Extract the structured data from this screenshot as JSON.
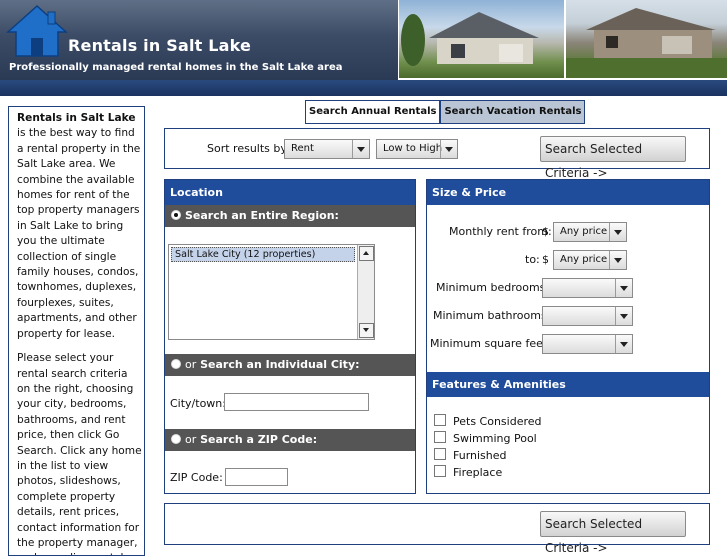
{
  "header": {
    "title": "Rentals in Salt Lake",
    "tagline": "Professionally managed rental homes in the Salt Lake area"
  },
  "sidebar": {
    "intro_bold": "Rentals in Salt Lake",
    "intro_rest": " is the best way to find a rental property in the Salt Lake area. We combine the available homes for rent of the top property managers in Salt Lake to bring you the ultimate collection of single family houses, condos, townhomes, duplexes, fourplexes, suites, apartments, and other property for lease.",
    "para2": "Please select your rental search criteria on the right, choosing your city, bedrooms, bathrooms, and rent price, then click Go Search. Click any home in the list to view photos, slideshows, complete property details, rent prices, contact information for the property manager, and an online rental"
  },
  "tabs": [
    "Search Annual Rentals",
    "Search Vacation Rentals"
  ],
  "sort": {
    "label": "Sort results by:",
    "field": "Rent",
    "order": "Low to High",
    "button": "Search Selected Criteria ->"
  },
  "location": {
    "title": "Location",
    "region_head": "Search an Entire Region:",
    "region_option": "Salt Lake City (12 properties)",
    "city_or": "or",
    "city_head": "Search an Individual City:",
    "city_label": "City/town:",
    "zip_or": "or",
    "zip_head": "Search a ZIP Code:",
    "zip_label": "ZIP Code:"
  },
  "size_price": {
    "title": "Size & Price",
    "rent_from_label": "Monthly rent from:",
    "to_label": "to:",
    "currency": "$",
    "rent_from_value": "Any price",
    "rent_to_value": "Any price",
    "bedrooms_label": "Minimum bedrooms:",
    "bathrooms_label": "Minimum bathrooms:",
    "sqft_label": "Minimum square feet:"
  },
  "features": {
    "title": "Features & Amenities",
    "items": [
      "Pets Considered",
      "Swimming Pool",
      "Furnished",
      "Fireplace"
    ]
  },
  "bottom": {
    "button": "Search Selected Criteria ->"
  },
  "colors": {
    "accent": "#1f4d9b",
    "header_dark": "#2a3a55",
    "subhead": "#555555"
  }
}
